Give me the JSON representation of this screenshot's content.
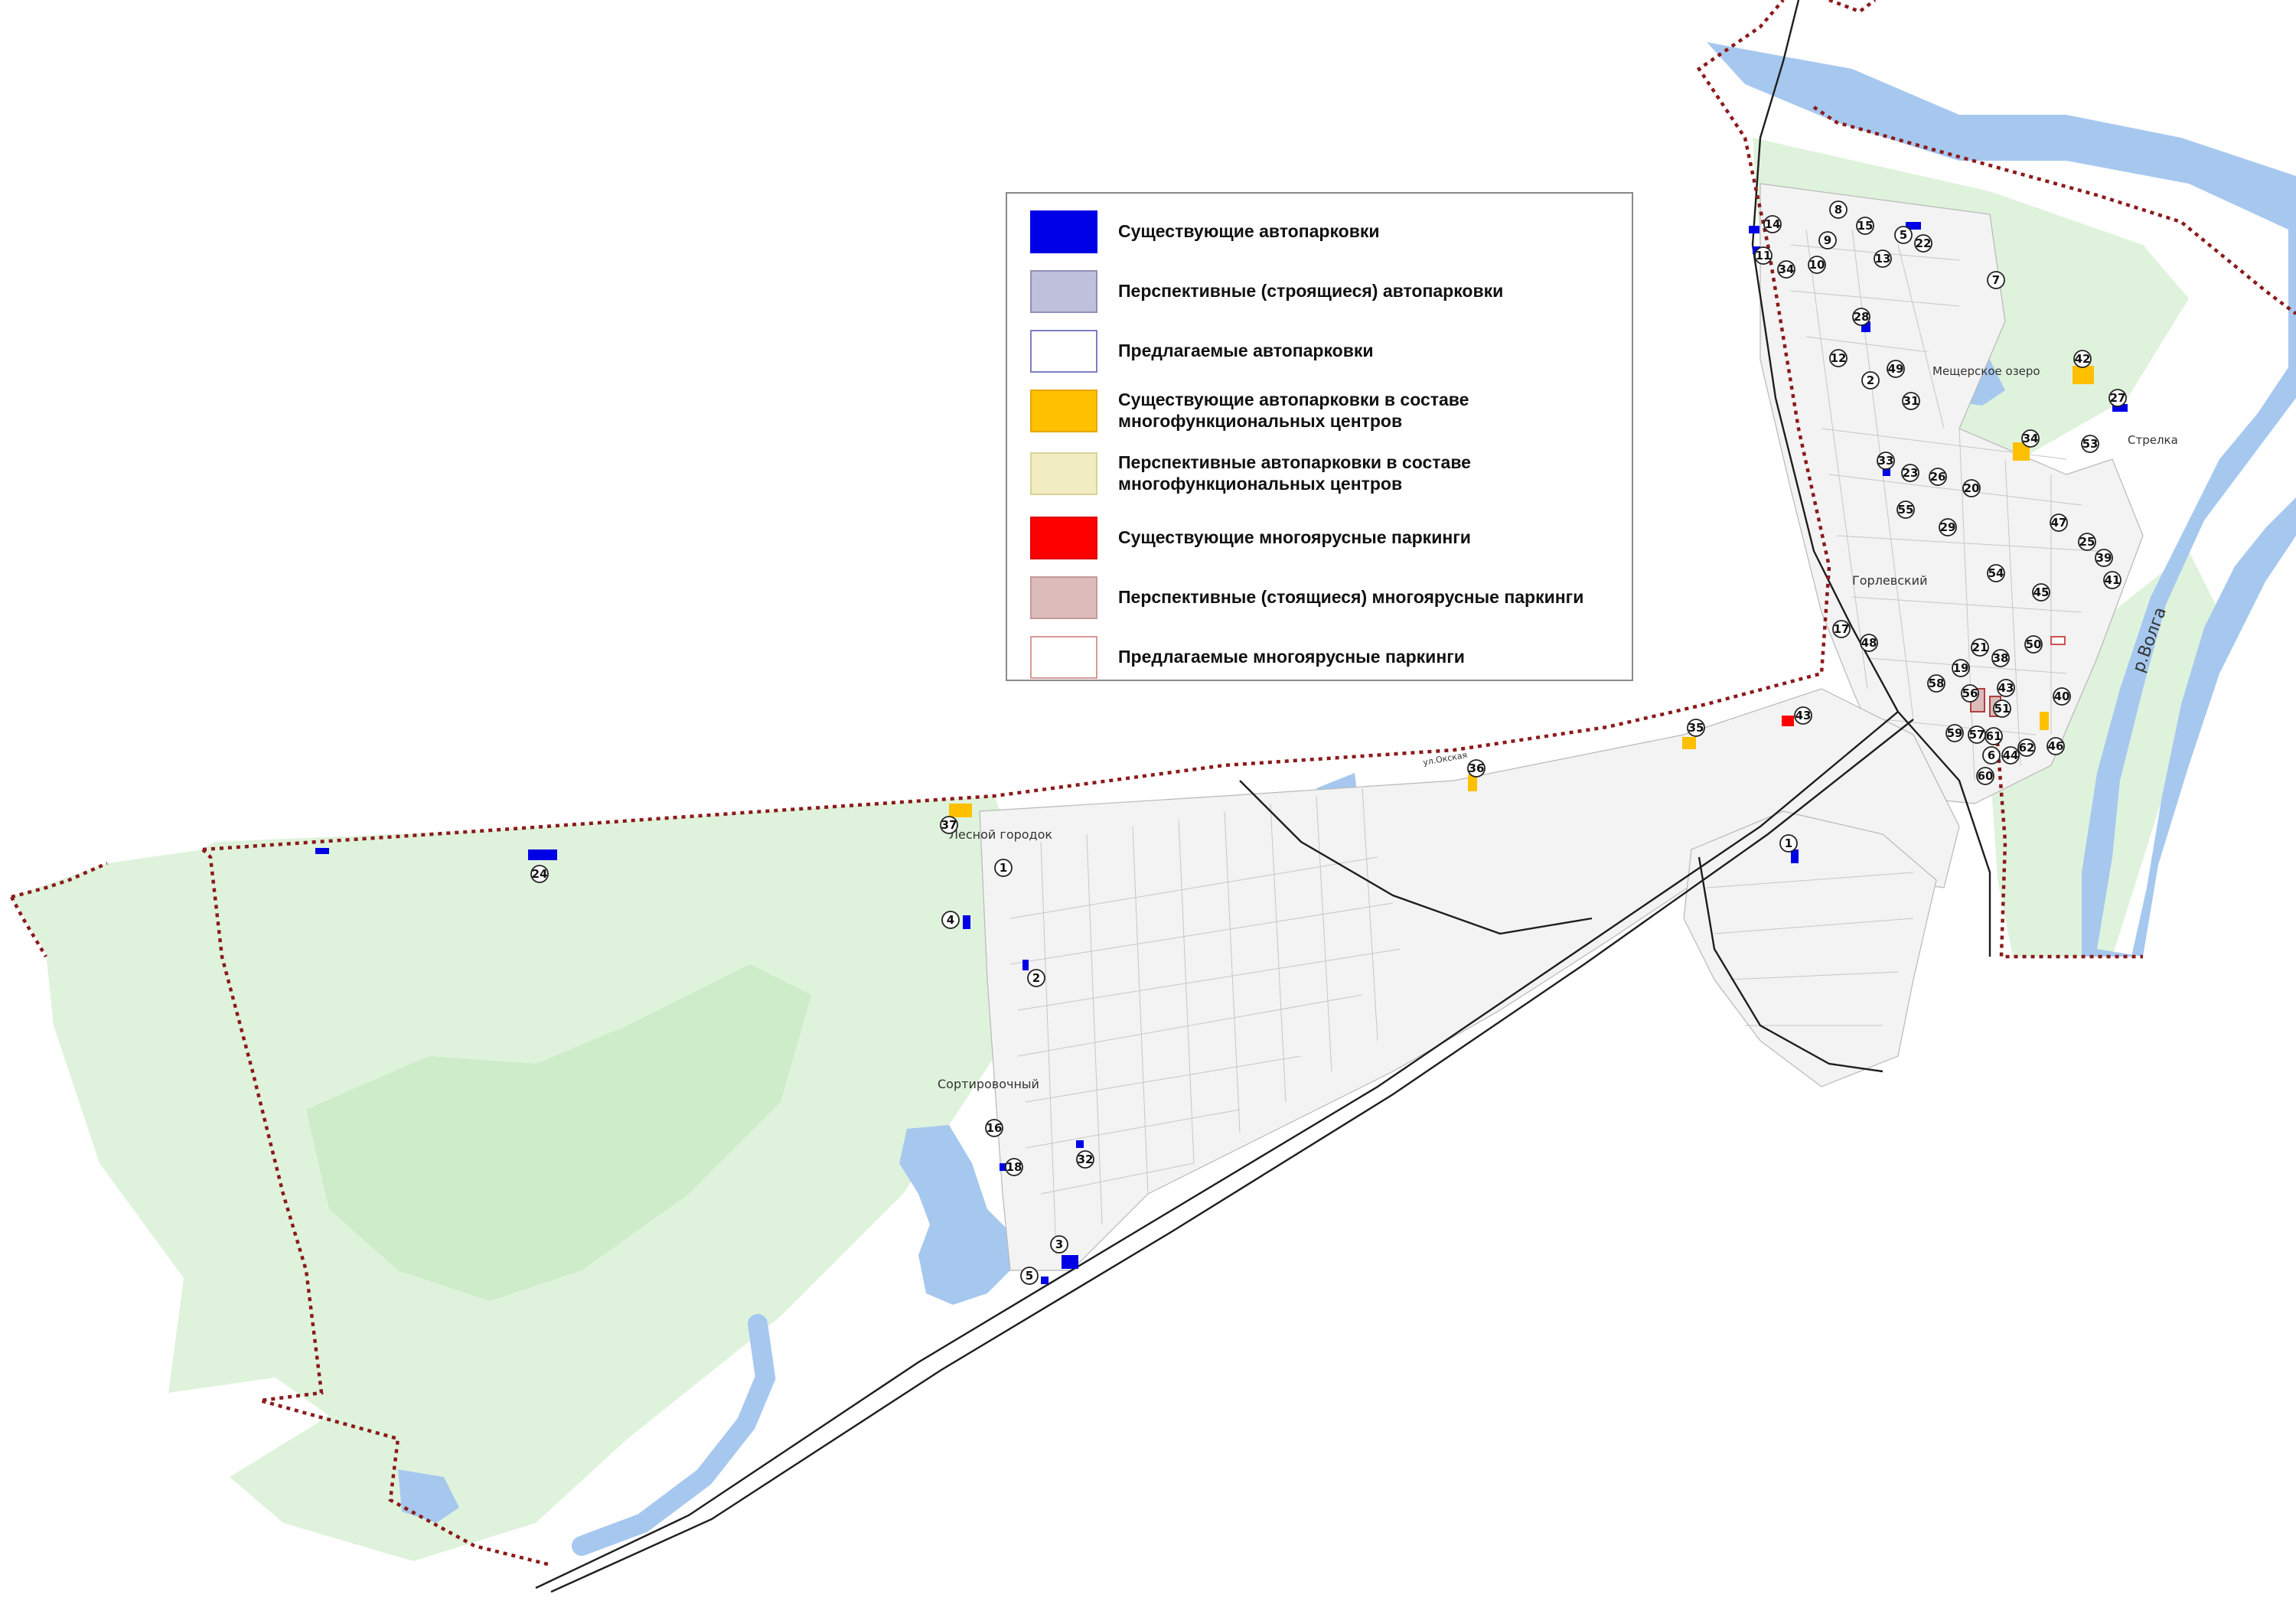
{
  "legend": {
    "items": [
      {
        "label": "Существующие автопарковки",
        "color": "#0000e6",
        "border": "#0000e6"
      },
      {
        "label": "Перспективные (строящиеся) автопарковки",
        "color": "#bfc0da",
        "border": "#8f90b8"
      },
      {
        "label": "Предлагаемые автопарковки",
        "color": "#ffffff",
        "border": "#7c7ec4"
      },
      {
        "label": "Существующие автопарковки в составе многофункциональных центров",
        "color": "#ffc000",
        "border": "#e6a800"
      },
      {
        "label": "Перспективные автопарковки в составе многофункциональных центров",
        "color": "#f1edc0",
        "border": "#d8d29a"
      },
      {
        "label": "Существующие многоярусные паркинги",
        "color": "#ff0000",
        "border": "#e00000"
      },
      {
        "label": "Перспективные (стоящиеся) многоярусные паркинги",
        "color": "#dcbbbb",
        "border": "#c49a9a"
      },
      {
        "label": "Предлагаемые многоярусные паркинги",
        "color": "#ffffff",
        "border": "#d89a9a"
      }
    ]
  },
  "place_labels": [
    {
      "text": "Лесной городок"
    },
    {
      "text": "Сортировочный"
    },
    {
      "text": "Горлевский"
    },
    {
      "text": "Мещерское озеро"
    },
    {
      "text": "Стрелка"
    },
    {
      "text": "ул.Окская"
    },
    {
      "text": "р.Волга"
    }
  ],
  "markers": [
    "14",
    "8",
    "15",
    "5",
    "22",
    "11",
    "9",
    "34",
    "10",
    "13",
    "7",
    "28",
    "12",
    "49",
    "2",
    "31",
    "42",
    "27",
    "34",
    "53",
    "33",
    "23",
    "26",
    "20",
    "55",
    "29",
    "47",
    "25",
    "39",
    "41",
    "54",
    "45",
    "17",
    "48",
    "21",
    "38",
    "50",
    "19",
    "58",
    "56",
    "43",
    "40",
    "51",
    "59",
    "57",
    "61",
    "6",
    "44",
    "62",
    "46",
    "60",
    "35",
    "43",
    "36",
    "37",
    "1",
    "24",
    "4",
    "1",
    "2",
    "16",
    "18",
    "32",
    "3",
    "5"
  ],
  "colors": {
    "water": "#a6c8ef",
    "forest": "#dff3dc",
    "forest_dark": "#c9e8c6",
    "boundary": "#8b1a1a",
    "street_block": "#f4f4f4",
    "rail": "#1e1e1e"
  }
}
